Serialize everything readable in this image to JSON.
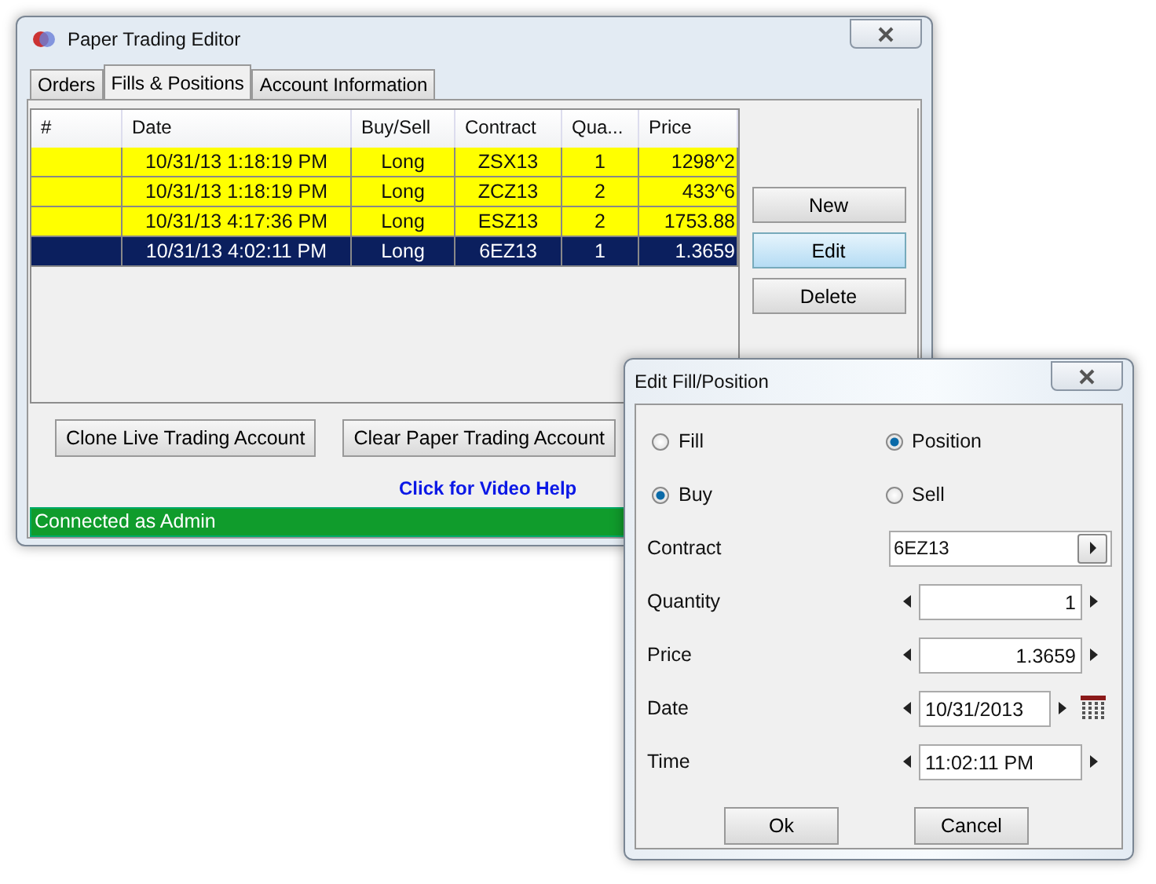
{
  "main_window": {
    "title": "Paper Trading Editor",
    "tabs": [
      {
        "label": "Orders",
        "selected": false
      },
      {
        "label": "Fills & Positions",
        "selected": true
      },
      {
        "label": "Account Information",
        "selected": false
      }
    ],
    "table": {
      "columns": [
        "#",
        "Date",
        "Buy/Sell",
        "Contract",
        "Qua...",
        "Price"
      ],
      "rows": [
        {
          "cells": [
            "",
            "10/31/13 1:18:19 PM",
            "Long",
            "ZSX13",
            "1",
            "1298^2"
          ],
          "selected": false
        },
        {
          "cells": [
            "",
            "10/31/13 1:18:19 PM",
            "Long",
            "ZCZ13",
            "2",
            "433^6"
          ],
          "selected": false
        },
        {
          "cells": [
            "",
            "10/31/13 4:17:36 PM",
            "Long",
            "ESZ13",
            "2",
            "1753.88"
          ],
          "selected": false
        },
        {
          "cells": [
            "",
            "10/31/13 4:02:11 PM",
            "Long",
            "6EZ13",
            "1",
            "1.3659"
          ],
          "selected": true
        }
      ]
    },
    "side_buttons": [
      {
        "label": "New",
        "selected": false
      },
      {
        "label": "Edit",
        "selected": true
      },
      {
        "label": "Delete",
        "selected": false
      }
    ],
    "bottom_buttons": [
      "Clone Live Trading Account",
      "Clear Paper Trading Account"
    ],
    "help_link": "Click for Video Help",
    "status_bar": "Connected as Admin"
  },
  "dialog": {
    "title": "Edit Fill/Position",
    "radio_rows": [
      [
        {
          "label": "Fill",
          "selected": false
        },
        {
          "label": "Position",
          "selected": true
        }
      ],
      [
        {
          "label": "Buy",
          "selected": true
        },
        {
          "label": "Sell",
          "selected": false
        }
      ]
    ],
    "fields": [
      {
        "label": "Contract",
        "kind": "combo",
        "value": "6EZ13"
      },
      {
        "label": "Quantity",
        "kind": "number",
        "value": "1"
      },
      {
        "label": "Price",
        "kind": "number",
        "value": "1.3659"
      },
      {
        "label": "Date",
        "kind": "date",
        "value": "10/31/2013"
      },
      {
        "label": "Time",
        "kind": "time",
        "value": "11:02:11 PM"
      }
    ],
    "buttons": [
      "Ok",
      "Cancel"
    ]
  }
}
